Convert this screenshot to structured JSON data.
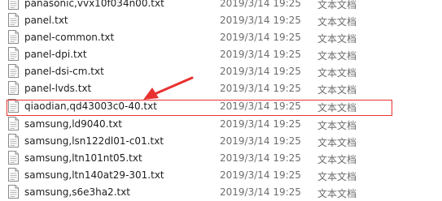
{
  "files": [
    {
      "name": "panasonic,vvx10f034n00.txt",
      "modified": "2019/3/14 19:25",
      "type": "文本文档"
    },
    {
      "name": "panel.txt",
      "modified": "2019/3/14 19:25",
      "type": "文本文档"
    },
    {
      "name": "panel-common.txt",
      "modified": "2019/3/14 19:25",
      "type": "文本文档"
    },
    {
      "name": "panel-dpi.txt",
      "modified": "2019/3/14 19:25",
      "type": "文本文档"
    },
    {
      "name": "panel-dsi-cm.txt",
      "modified": "2019/3/14 19:25",
      "type": "文本文档"
    },
    {
      "name": "panel-lvds.txt",
      "modified": "2019/3/14 19:25",
      "type": "文本文档"
    },
    {
      "name": "qiaodian,qd43003c0-40.txt",
      "modified": "2019/3/14 19:25",
      "type": "文本文档"
    },
    {
      "name": "samsung,ld9040.txt",
      "modified": "2019/3/14 19:25",
      "type": "文本文档"
    },
    {
      "name": "samsung,lsn122dl01-c01.txt",
      "modified": "2019/3/14 19:25",
      "type": "文本文档"
    },
    {
      "name": "samsung,ltn101nt05.txt",
      "modified": "2019/3/14 19:25",
      "type": "文本文档"
    },
    {
      "name": "samsung,ltn140at29-301.txt",
      "modified": "2019/3/14 19:25",
      "type": "文本文档"
    },
    {
      "name": "samsung,s6e3ha2.txt",
      "modified": "2019/3/14 19:25",
      "type": "文本文档"
    }
  ],
  "icon": "text-file-icon",
  "annotation": {
    "highlighted_file_index": 6,
    "color": "#e8312f"
  }
}
